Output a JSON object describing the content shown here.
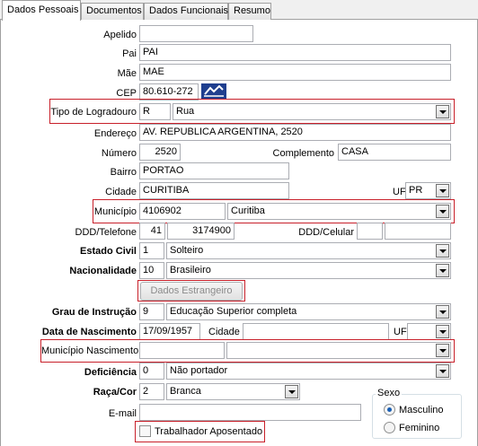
{
  "tabs": [
    "Dados Pessoais",
    "Documentos",
    "Dados Funcionais",
    "Resumo"
  ],
  "labels": {
    "apelido": "Apelido",
    "pai": "Pai",
    "mae": "Mãe",
    "cep": "CEP",
    "tipo_logradouro": "Tipo de Logradouro",
    "endereco": "Endereço",
    "numero": "Número",
    "complemento": "Complemento",
    "bairro": "Bairro",
    "cidade": "Cidade",
    "uf": "UF",
    "municipio": "Município",
    "ddd_telefone": "DDD/Telefone",
    "ddd_celular": "DDD/Celular",
    "estado_civil": "Estado Civil",
    "nacionalidade": "Nacionalidade",
    "grau_instrucao": "Grau de Instrução",
    "data_nascimento": "Data de Nascimento",
    "cidade2": "Cidade",
    "uf2": "UF",
    "municipio_nascimento": "Município Nascimento",
    "deficiencia": "Deficiência",
    "raca_cor": "Raça/Cor",
    "email": "E-mail",
    "sexo": "Sexo"
  },
  "values": {
    "apelido": "",
    "pai": "PAI",
    "mae": "MAE",
    "cep": "80.610-272",
    "tipo_logradouro_code": "R",
    "tipo_logradouro": "Rua",
    "endereco": "AV. REPUBLICA ARGENTINA, 2520",
    "numero": "2520",
    "complemento": "CASA",
    "bairro": "PORTAO",
    "cidade": "CURITIBA",
    "uf": "PR",
    "municipio_code": "4106902",
    "municipio": "Curitiba",
    "ddd": "41",
    "telefone": "3174900",
    "ddd_celular": "",
    "celular": "",
    "estado_civil_code": "1",
    "estado_civil": "Solteiro",
    "nacionalidade_code": "10",
    "nacionalidade": "Brasileiro",
    "grau_instrucao_code": "9",
    "grau_instrucao": "Educação Superior completa",
    "data_nascimento": "17/09/1957",
    "cidade_nascimento": "",
    "uf_nascimento": "",
    "municipio_nascimento_code": "",
    "municipio_nascimento": "",
    "deficiencia_code": "0",
    "deficiencia": "Não portador",
    "raca_cor_code": "2",
    "raca_cor": "Branca",
    "email": ""
  },
  "buttons": {
    "dados_estrangeiro": "Dados Estrangeiro"
  },
  "sexo": {
    "options": [
      "Masculino",
      "Feminino"
    ],
    "selected": "Masculino"
  },
  "checkbox": {
    "trabalhador_aposentado": "Trabalhador Aposentado",
    "checked": false
  },
  "colors": {
    "highlight": "#c8202a"
  }
}
